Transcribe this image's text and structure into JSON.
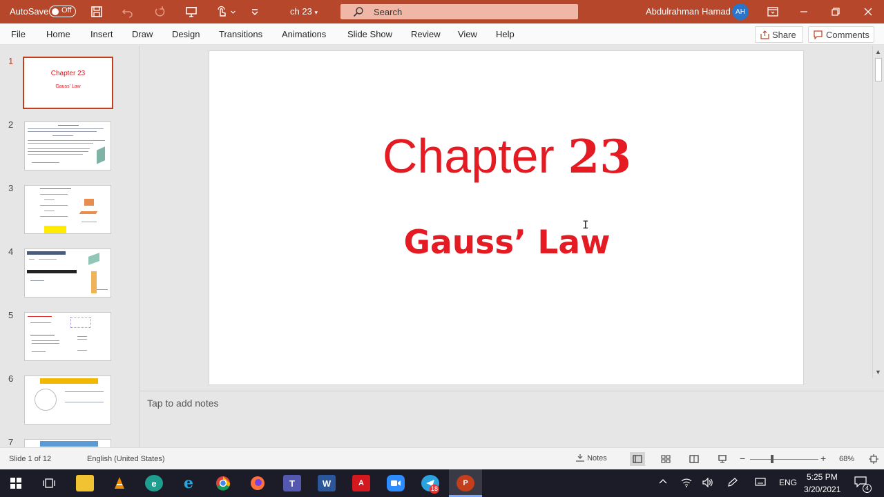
{
  "app": {
    "autosave_label": "AutoSave",
    "autosave_state": "Off",
    "doc_name": "ch 23",
    "search_placeholder": "Search",
    "user_name": "Abdulrahman Hamad",
    "user_initials": "AH",
    "brand_color": "#b7472a"
  },
  "menu": {
    "tabs": [
      "File",
      "Home",
      "Insert",
      "Draw",
      "Design",
      "Transitions",
      "Animations",
      "Slide Show",
      "Review",
      "View",
      "Help"
    ],
    "share_label": "Share",
    "comments_label": "Comments"
  },
  "thumbnails": {
    "numbers": [
      "1",
      "2",
      "3",
      "4",
      "5",
      "6",
      "7"
    ],
    "slide1_title": "Chapter 23",
    "slide1_subtitle": "Gauss’ Law"
  },
  "slide": {
    "title_text": "Chapter ",
    "title_number": "23",
    "subtitle": "Gauss’ Law",
    "text_color": "#e41b23"
  },
  "notes": {
    "placeholder": "Tap to add notes"
  },
  "status": {
    "slide_info": "Slide 1 of 12",
    "language": "English (United States)",
    "notes_label": "Notes",
    "zoom_minus": "−",
    "zoom_plus": "+",
    "zoom": "68%"
  },
  "taskbar": {
    "language": "ENG",
    "time": "5:25 PM",
    "date": "3/20/2021",
    "notification_count": "4",
    "telegram_badge": "18"
  }
}
